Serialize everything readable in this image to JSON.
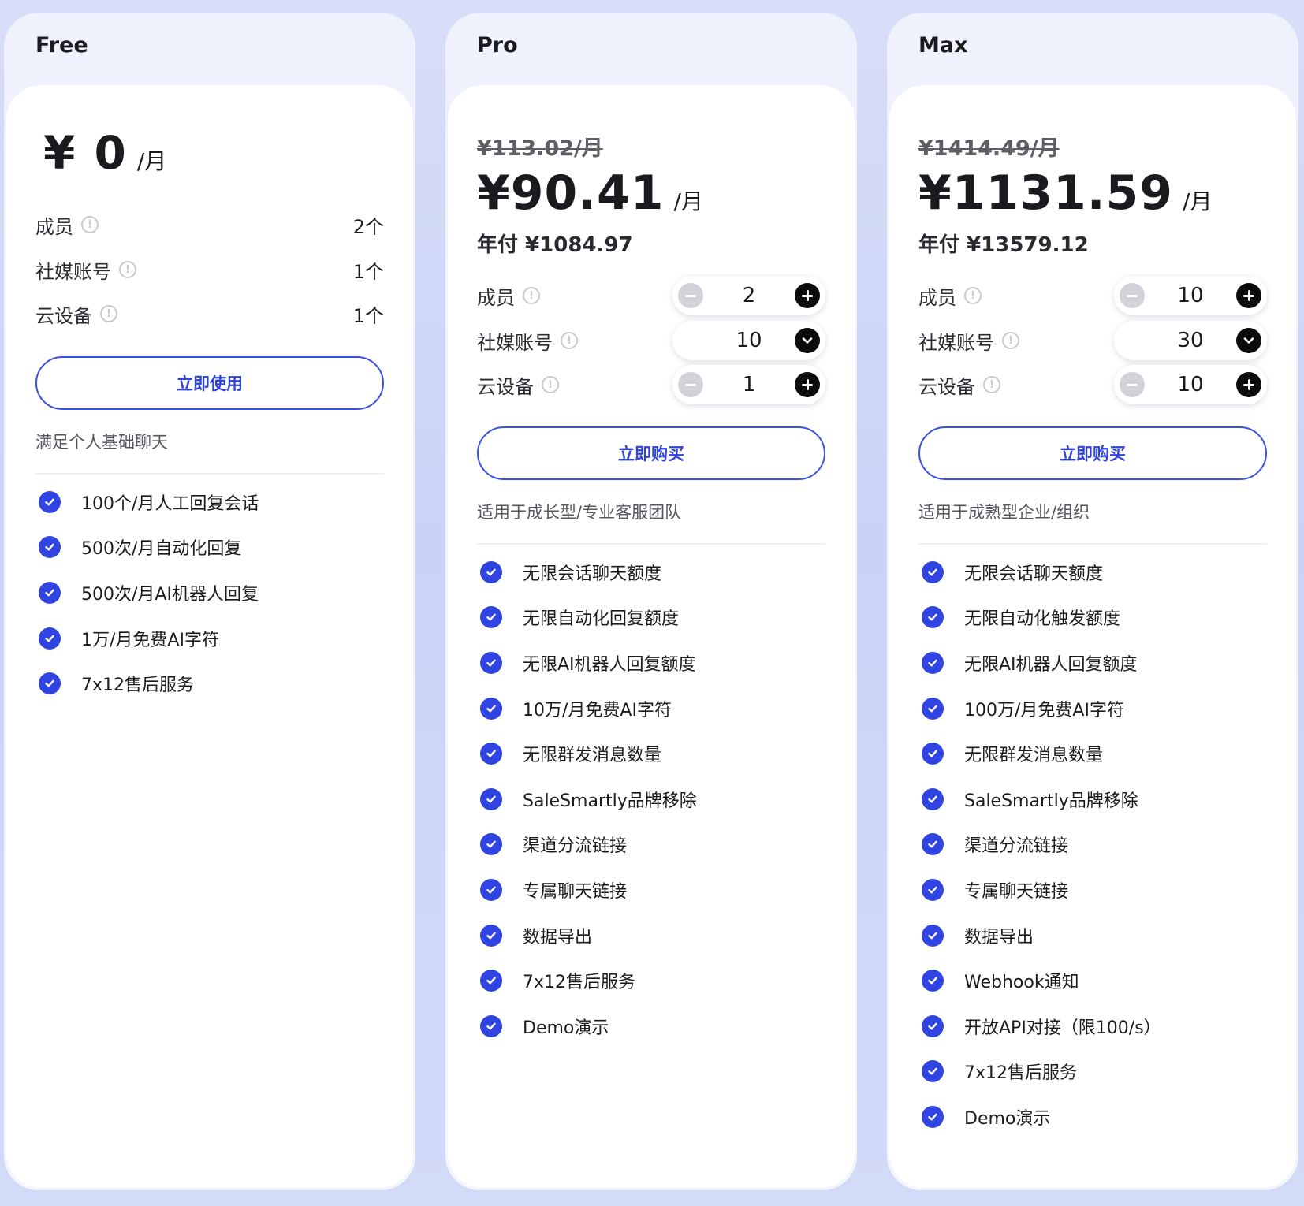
{
  "plans": [
    {
      "name": "Free",
      "price": "¥ 0",
      "unit": "/月",
      "quotas": [
        {
          "label": "成员",
          "value": "2个"
        },
        {
          "label": "社媒账号",
          "value": "1个"
        },
        {
          "label": "云设备",
          "value": "1个"
        }
      ],
      "cta": "立即使用",
      "description": "满足个人基础聊天",
      "features": [
        "100个/月人工回复会话",
        "500次/月自动化回复",
        "500次/月AI机器人回复",
        "1万/月免费AI字符",
        "7x12售后服务"
      ]
    },
    {
      "name": "Pro",
      "old_price": "¥113.02/月",
      "price": "¥90.41",
      "unit": "/月",
      "annual": "年付 ¥1084.97",
      "quotas": [
        {
          "label": "成员",
          "value": "2"
        },
        {
          "label": "社媒账号",
          "value": "10"
        },
        {
          "label": "云设备",
          "value": "1"
        }
      ],
      "cta": "立即购买",
      "description": "适用于成长型/专业客服团队",
      "features": [
        "无限会话聊天额度",
        "无限自动化回复额度",
        "无限AI机器人回复额度",
        "10万/月免费AI字符",
        "无限群发消息数量",
        "SaleSmartly品牌移除",
        "渠道分流链接",
        "专属聊天链接",
        "数据导出",
        "7x12售后服务",
        "Demo演示"
      ]
    },
    {
      "name": "Max",
      "old_price": "¥1414.49/月",
      "price": "¥1131.59",
      "unit": "/月",
      "annual": "年付 ¥13579.12",
      "quotas": [
        {
          "label": "成员",
          "value": "10"
        },
        {
          "label": "社媒账号",
          "value": "30"
        },
        {
          "label": "云设备",
          "value": "10"
        }
      ],
      "cta": "立即购买",
      "description": "适用于成熟型企业/组织",
      "features": [
        "无限会话聊天额度",
        "无限自动化触发额度",
        "无限AI机器人回复额度",
        "100万/月免费AI字符",
        "无限群发消息数量",
        "SaleSmartly品牌移除",
        "渠道分流链接",
        "专属聊天链接",
        "数据导出",
        "Webhook通知",
        "开放API对接（限100/s）",
        "7x12售后服务",
        "Demo演示"
      ]
    }
  ],
  "icons": {
    "info": "info-circle-icon",
    "check": "check-circle-icon",
    "minus": "minus-circle-icon",
    "plus": "plus-circle-icon",
    "dropdown": "chevron-down-icon"
  },
  "colors": {
    "accent": "#2f44e0",
    "border_accent": "#3d51e0",
    "background": "#c9d3f6"
  }
}
